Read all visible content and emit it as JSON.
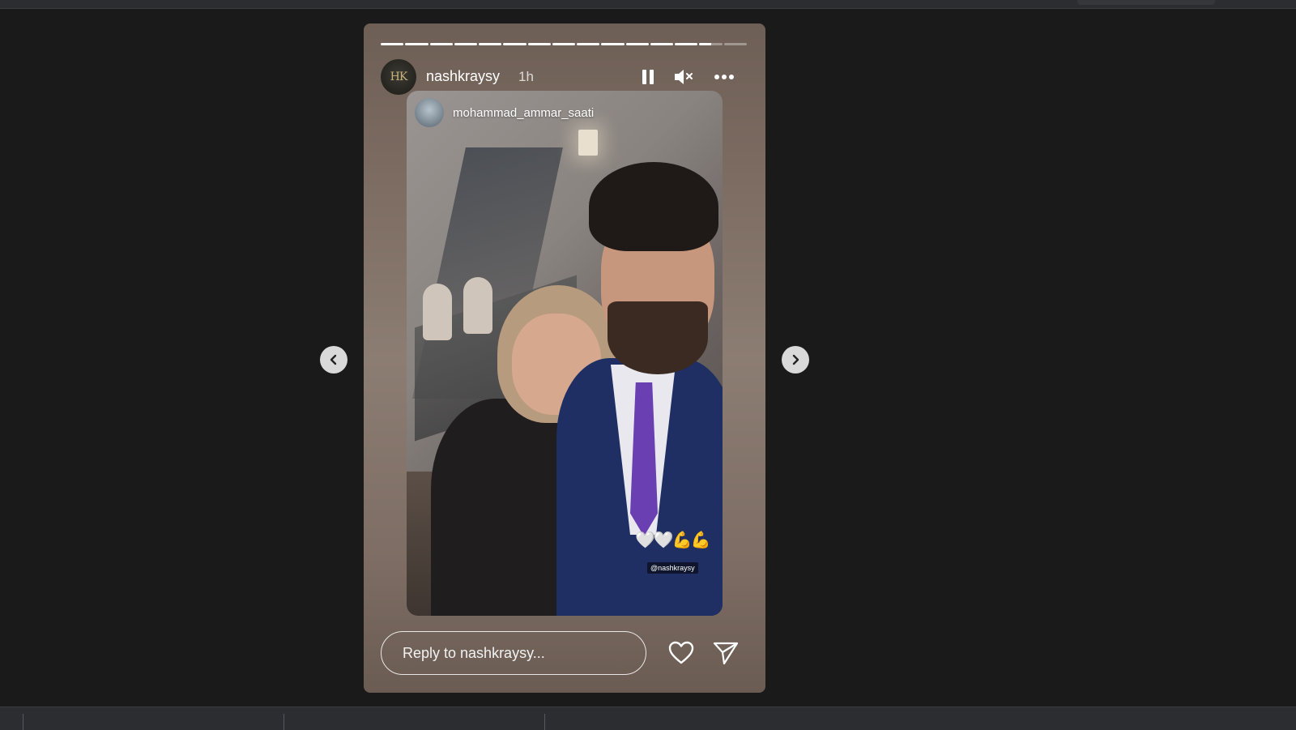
{
  "story": {
    "username": "nashkraysy",
    "time_ago": "1h",
    "avatar_monogram": "HK",
    "progress": {
      "segments": 15,
      "completed": 13,
      "current_fraction": 0.5
    },
    "controls": {
      "pause_icon": "pause-icon",
      "mute_icon": "mute-icon",
      "more_icon": "more-options-icon"
    },
    "repost": {
      "username": "mohammad_ammar_saati"
    },
    "stickers": {
      "emoji_text": "🤍🤍💪💪",
      "mention": "@nashkraysy"
    },
    "reply": {
      "placeholder": "Reply to nashkraysy...",
      "value": ""
    },
    "actions": {
      "like_icon": "heart-icon",
      "share_icon": "send-icon"
    }
  },
  "navigation": {
    "prev_icon": "chevron-left-icon",
    "next_icon": "chevron-right-icon"
  },
  "colors": {
    "page_background": "#1a1a1a",
    "tie_purple": "#6a3fb1",
    "suit_navy": "#1f2f63"
  }
}
